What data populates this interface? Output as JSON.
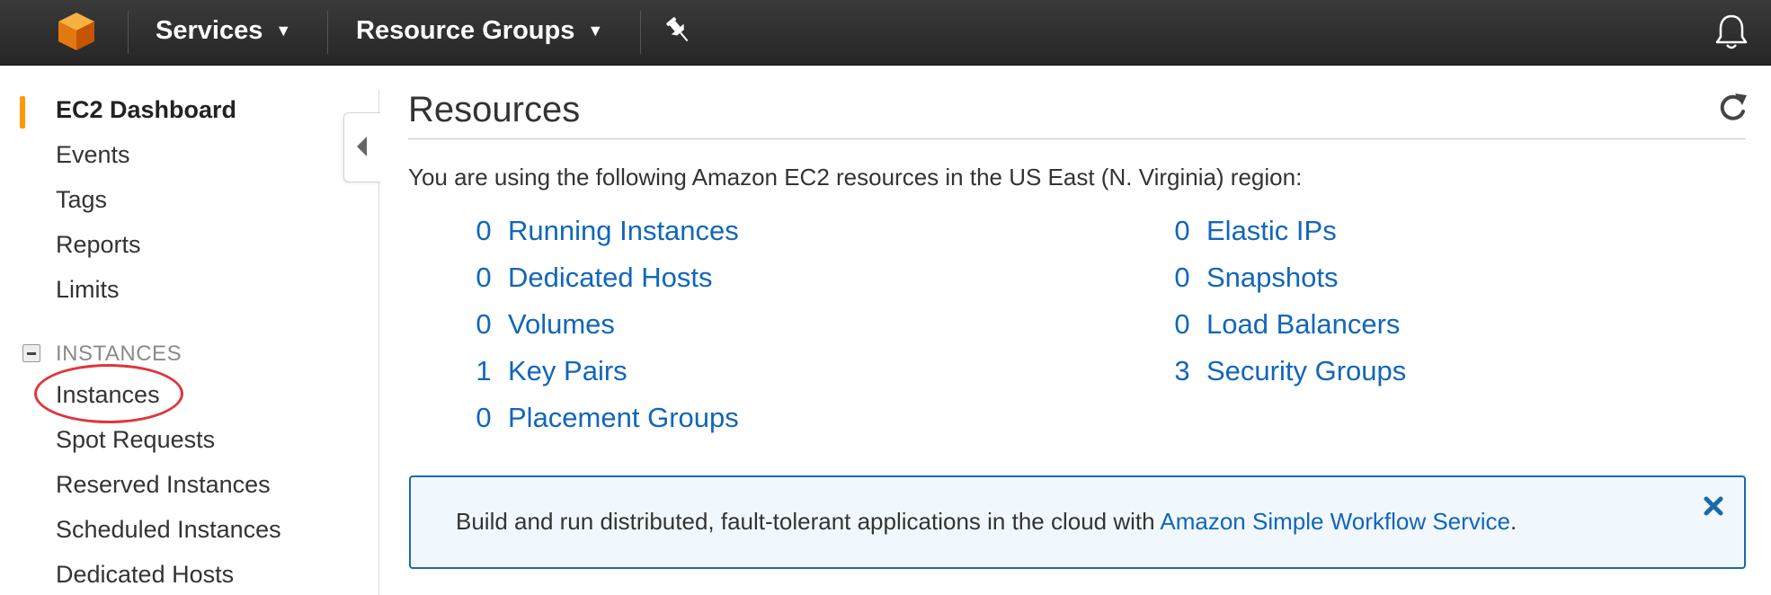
{
  "topnav": {
    "services_label": "Services",
    "resource_groups_label": "Resource Groups",
    "icons": [
      "aws-cube-logo",
      "chevron-down-icon",
      "pin-icon",
      "bell-icon"
    ]
  },
  "sidebar": {
    "items": [
      {
        "label": "EC2 Dashboard"
      },
      {
        "label": "Events"
      },
      {
        "label": "Tags"
      },
      {
        "label": "Reports"
      },
      {
        "label": "Limits"
      }
    ],
    "instances_section": {
      "header": "INSTANCES",
      "items": [
        {
          "label": "Instances"
        },
        {
          "label": "Spot Requests"
        },
        {
          "label": "Reserved Instances"
        },
        {
          "label": "Scheduled Instances"
        },
        {
          "label": "Dedicated Hosts"
        }
      ]
    }
  },
  "main": {
    "title": "Resources",
    "intro": "You are using the following Amazon EC2 resources in the US East (N. Virginia) region:",
    "resources_left": [
      {
        "count": "0",
        "label": "Running Instances"
      },
      {
        "count": "0",
        "label": "Dedicated Hosts"
      },
      {
        "count": "0",
        "label": "Volumes"
      },
      {
        "count": "1",
        "label": "Key Pairs"
      },
      {
        "count": "0",
        "label": "Placement Groups"
      }
    ],
    "resources_right": [
      {
        "count": "0",
        "label": "Elastic IPs"
      },
      {
        "count": "0",
        "label": "Snapshots"
      },
      {
        "count": "0",
        "label": "Load Balancers"
      },
      {
        "count": "3",
        "label": "Security Groups"
      }
    ],
    "banner": {
      "text": "Build and run distributed, fault-tolerant applications in the cloud with",
      "link": "Amazon Simple Workflow Service",
      "suffix": "."
    }
  },
  "colors": {
    "nav_bg": "#2d2d2d",
    "accent_orange": "#ff9900",
    "link_blue": "#1166bb",
    "banner_border": "#1a6aa8",
    "annotation_red": "#e0353a"
  }
}
